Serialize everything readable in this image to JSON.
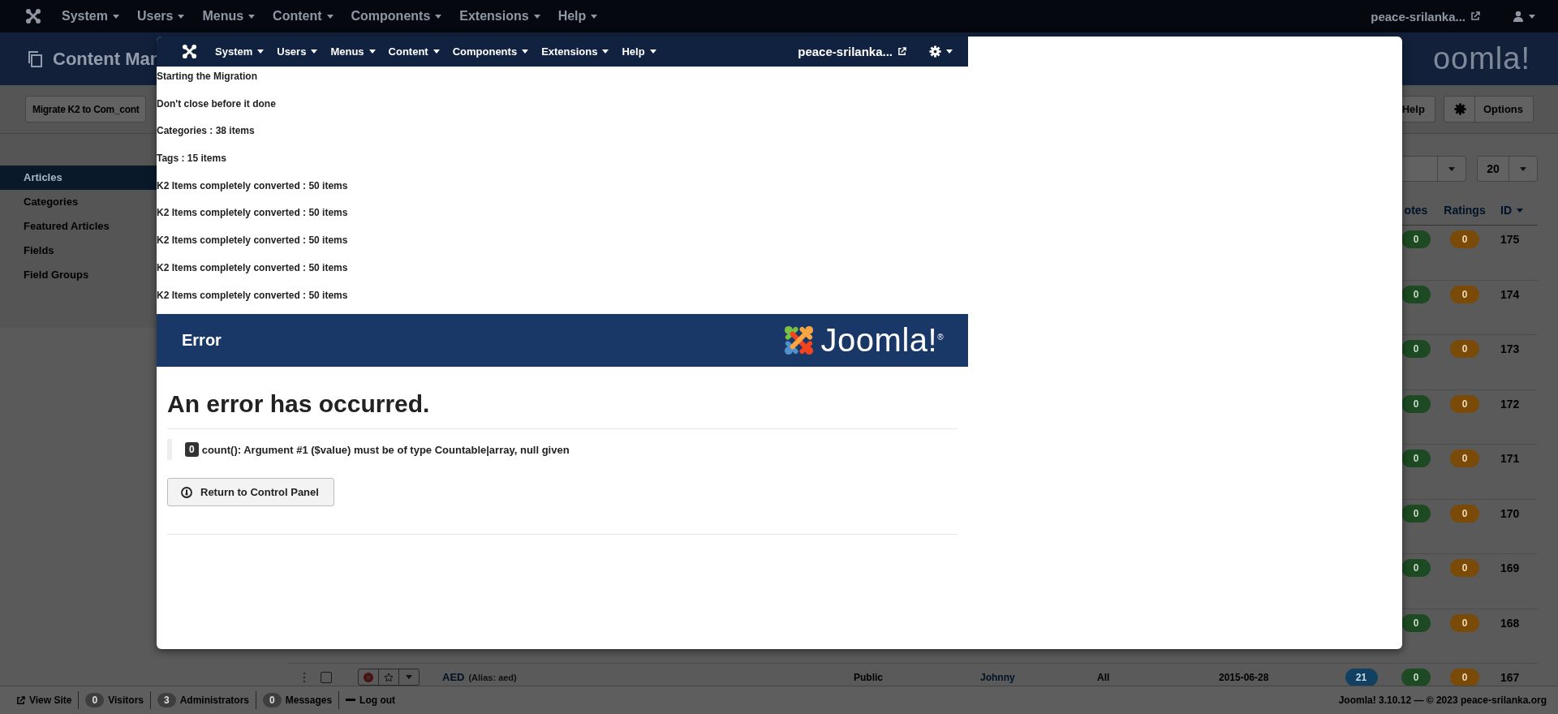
{
  "top_nav": {
    "menus": [
      "System",
      "Users",
      "Menus",
      "Content",
      "Components",
      "Extensions",
      "Help"
    ],
    "site_link": "peace-srilanka..."
  },
  "header": {
    "title": "Content Man",
    "logo_text": "oomla!"
  },
  "toolbar": {
    "migrate_button": "Migrate K2 to Com_cont",
    "help_button": "Help",
    "options_button": "Options"
  },
  "sidebar": {
    "items": [
      {
        "label": "Articles",
        "selected": true
      },
      {
        "label": "Categories",
        "selected": false
      },
      {
        "label": "Featured Articles",
        "selected": false
      },
      {
        "label": "Fields",
        "selected": false
      },
      {
        "label": "Field Groups",
        "selected": false
      }
    ]
  },
  "filters": {
    "limit": "20"
  },
  "table": {
    "columns": [
      "otes",
      "Ratings",
      "ID"
    ],
    "rows": [
      {
        "votes": "0",
        "ratings": "0",
        "id": "175"
      },
      {
        "votes": "0",
        "ratings": "0",
        "id": "174"
      },
      {
        "votes": "0",
        "ratings": "0",
        "id": "173"
      },
      {
        "votes": "0",
        "ratings": "0",
        "id": "172"
      },
      {
        "votes": "0",
        "ratings": "0",
        "id": "171"
      },
      {
        "votes": "0",
        "ratings": "0",
        "id": "170"
      },
      {
        "votes": "0",
        "ratings": "0",
        "id": "169"
      },
      {
        "votes": "0",
        "ratings": "0",
        "id": "168"
      },
      {
        "checked": false,
        "published": false,
        "featured": false,
        "title": "AED",
        "alias": "(Alias: aed)",
        "access": "Public",
        "author": "Johnny",
        "language": "All",
        "date": "2015-06-28",
        "hits": "21",
        "votes": "0",
        "ratings": "0",
        "id": "167"
      }
    ]
  },
  "status_bar": {
    "items": [
      {
        "kind": "link",
        "label": "View Site"
      },
      {
        "kind": "count",
        "count": "0",
        "label": "Visitors"
      },
      {
        "kind": "count",
        "count": "3",
        "label": "Administrators"
      },
      {
        "kind": "count",
        "count": "0",
        "label": "Messages"
      },
      {
        "kind": "logout",
        "label": "Log out"
      }
    ],
    "version": "Joomla! 3.10.12 — © 2023 peace-srilanka.org"
  },
  "modal": {
    "nav": {
      "menus": [
        "System",
        "Users",
        "Menus",
        "Content",
        "Components",
        "Extensions",
        "Help"
      ],
      "site_link": "peace-srilanka..."
    },
    "log": [
      "Starting the Migration",
      "Don't close before it done",
      "Categories : 38 items",
      "Tags : 15 items",
      "K2 Items completely converted : 50 items",
      "K2 Items completely converted : 50 items",
      "K2 Items completely converted : 50 items",
      "K2 Items completely converted : 50 items",
      "K2 Items completely converted : 50 items"
    ],
    "error": {
      "title": "Error",
      "logo": "Joomla!$^{®}$",
      "heading": "An error has occurred.",
      "code": "0",
      "message": "count(): Argument #1 ($value) must be of type Countable|array, null given",
      "button": "Return to Control Panel"
    }
  }
}
